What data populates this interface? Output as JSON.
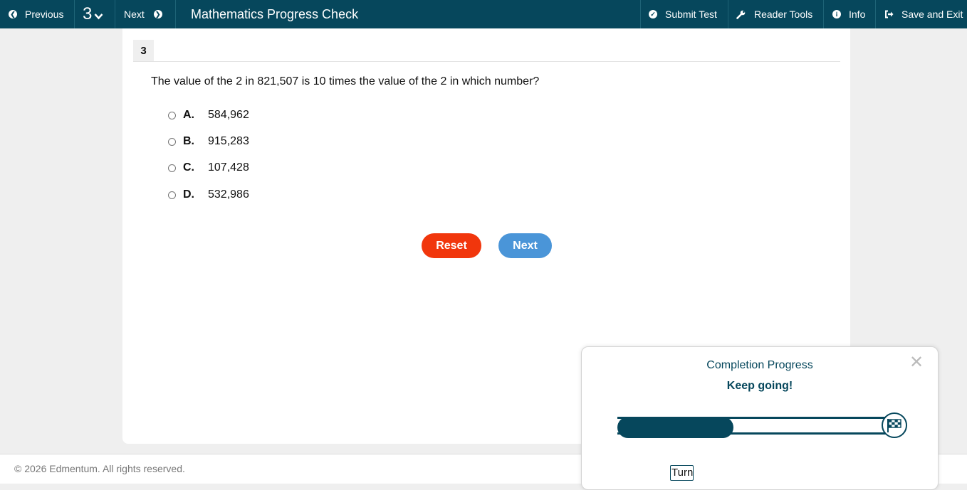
{
  "topbar": {
    "previous_label": "Previous",
    "question_selector": "3",
    "next_label": "Next",
    "title": "Mathematics Progress Check",
    "submit_label": "Submit Test",
    "reader_tools_label": "Reader Tools",
    "info_label": "Info",
    "save_exit_label": "Save and Exit"
  },
  "question": {
    "number": "3",
    "text": "The value of the 2 in 821,507 is 10 times the value of the 2 in which number?",
    "choices": [
      {
        "letter": "A.",
        "value": "584,962"
      },
      {
        "letter": "B.",
        "value": "915,283"
      },
      {
        "letter": "C.",
        "value": "107,428"
      },
      {
        "letter": "D.",
        "value": "532,986"
      }
    ],
    "reset_label": "Reset",
    "next_label": "Next"
  },
  "footer": {
    "copyright": "© 2026 Edmentum. All rights reserved."
  },
  "progress_popup": {
    "title": "Completion Progress",
    "subtitle": "Keep going!",
    "close_glyph": "✕",
    "progress_fraction": 0.4,
    "turn_off_label": "Turn off"
  },
  "colors": {
    "topbar": "#06475c",
    "reset": "#f1360c",
    "next": "#4a95d8",
    "progress": "#06475c"
  }
}
